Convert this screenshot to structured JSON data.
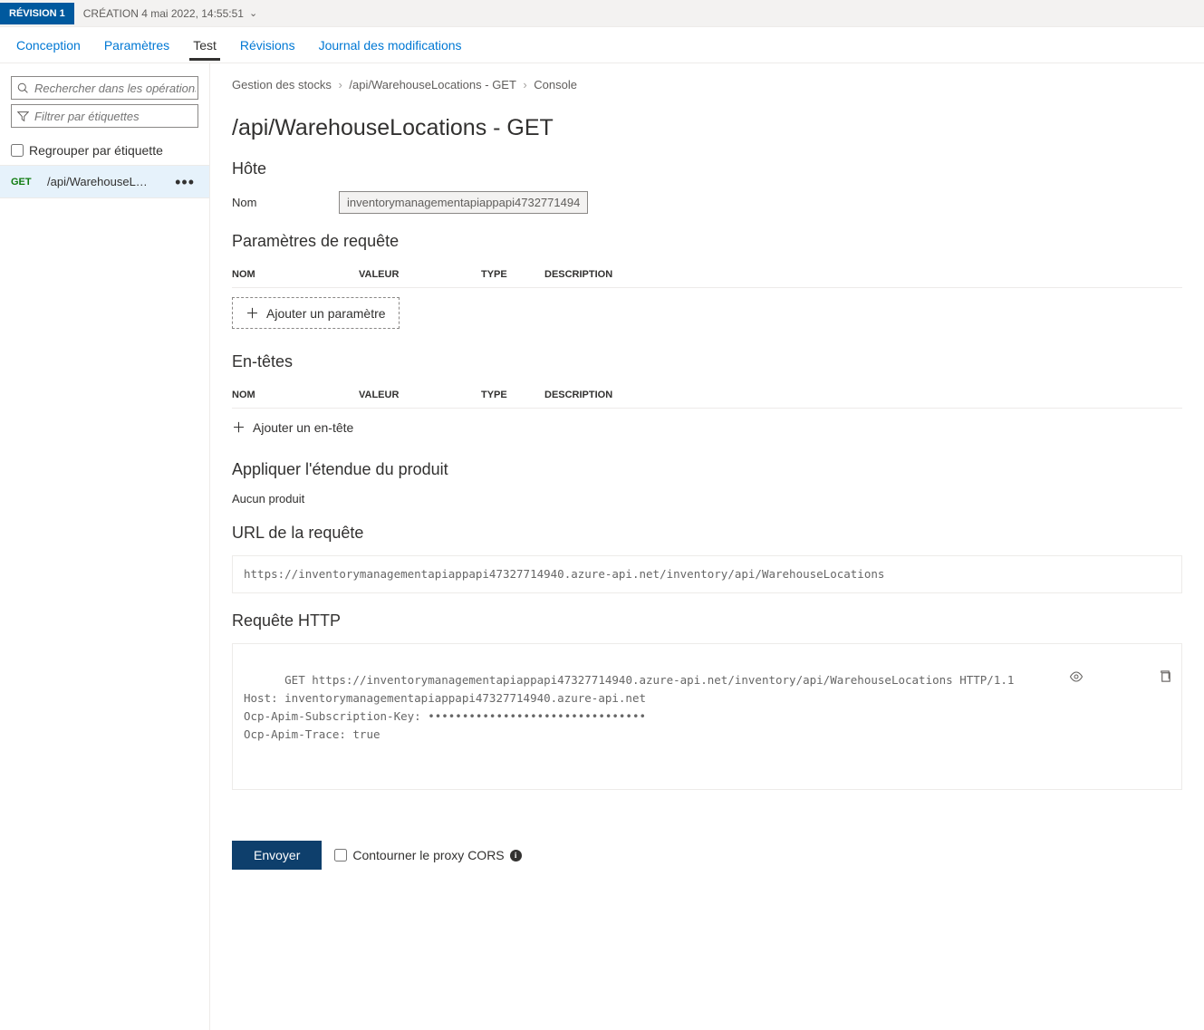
{
  "topbar": {
    "revision_label": "RÉVISION 1",
    "creation_label": "CRÉATION 4 mai 2022, 14:55:51"
  },
  "tabs": {
    "design": "Conception",
    "params": "Paramètres",
    "test": "Test",
    "revisions": "Révisions",
    "changelog": "Journal des modifications"
  },
  "side": {
    "search_placeholder": "Rechercher dans les opérations",
    "filter_placeholder": "Filtrer par étiquettes",
    "group_label": "Regrouper par étiquette",
    "op_verb": "GET",
    "op_path": "/api/WarehouseL…"
  },
  "crumb": {
    "a": "Gestion des stocks",
    "b": "/api/WarehouseLocations - GET",
    "c": "Console"
  },
  "title": "/api/WarehouseLocations - GET",
  "host": {
    "heading": "Hôte",
    "name_label": "Nom",
    "name_value": "inventorymanagementapiappapi4732771494"
  },
  "qparams": {
    "heading": "Paramètres de requête",
    "cols": {
      "name": "NOM",
      "value": "VALEUR",
      "type": "TYPE",
      "desc": "DESCRIPTION"
    },
    "add": "Ajouter un paramètre"
  },
  "headers": {
    "heading": "En-têtes",
    "cols": {
      "name": "NOM",
      "value": "VALEUR",
      "type": "TYPE",
      "desc": "DESCRIPTION"
    },
    "add": "Ajouter un en-tête"
  },
  "scope": {
    "heading": "Appliquer l'étendue du produit",
    "none": "Aucun produit"
  },
  "url": {
    "heading": "URL de la requête",
    "value": "https://inventorymanagementapiappapi47327714940.azure-api.net/inventory/api/WarehouseLocations"
  },
  "http": {
    "heading": "Requête HTTP",
    "body": "GET https://inventorymanagementapiappapi47327714940.azure-api.net/inventory/api/WarehouseLocations HTTP/1.1\nHost: inventorymanagementapiappapi47327714940.azure-api.net\nOcp-Apim-Subscription-Key: ••••••••••••••••••••••••••••••••\nOcp-Apim-Trace: true"
  },
  "bottom": {
    "send": "Envoyer",
    "cors": "Contourner le proxy CORS"
  }
}
